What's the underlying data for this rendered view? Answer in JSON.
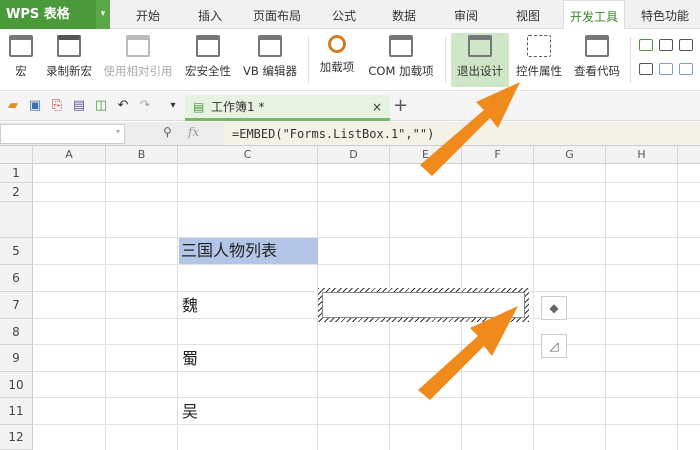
{
  "app": {
    "logo": "WPS 表格"
  },
  "tabs": [
    "开始",
    "插入",
    "页面布局",
    "公式",
    "数据",
    "审阅",
    "视图",
    "开发工具",
    "特色功能"
  ],
  "active_tab": "开发工具",
  "ribbon": [
    "宏",
    "录制新宏",
    "使用相对引用",
    "宏安全性",
    "VB 编辑器",
    "加载项",
    "COM 加载项",
    "退出设计",
    "控件属性",
    "查看代码"
  ],
  "document": {
    "tab_title": "工作簿1 *",
    "close": "×",
    "new_tab": "+"
  },
  "formula_bar": {
    "fx": "fx",
    "formula": "=EMBED(\"Forms.ListBox.1\",\"\")"
  },
  "columns": [
    "A",
    "B",
    "C",
    "D",
    "E",
    "F",
    "G",
    "H"
  ],
  "rows": [
    "1",
    "2",
    "5",
    "6",
    "7",
    "8",
    "9",
    "10",
    "11",
    "12"
  ],
  "cells": {
    "C5": "三国人物列表",
    "C7": "魏",
    "C9": "蜀",
    "C11": "吴"
  },
  "colors": {
    "brand": "#4a9a3c",
    "header_cell": "#b4c6e7",
    "arrow": "#f08a1c"
  }
}
